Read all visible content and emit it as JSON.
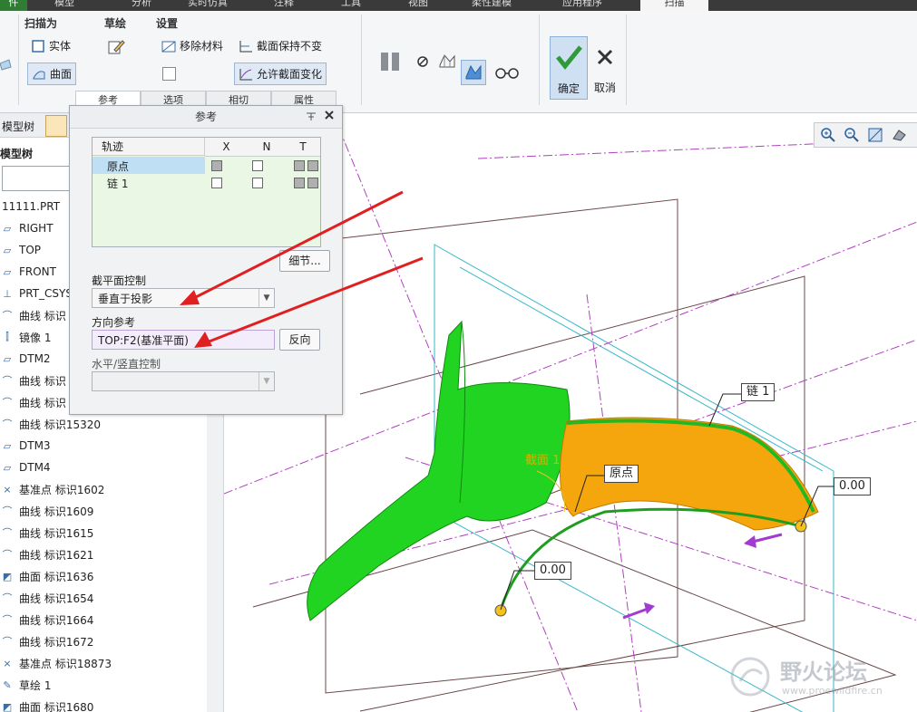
{
  "tabs": [
    {
      "label": "件"
    },
    {
      "label": "模型"
    },
    {
      "label": "分析"
    },
    {
      "label": "实时仿真"
    },
    {
      "label": "注释"
    },
    {
      "label": "工具"
    },
    {
      "label": "视图"
    },
    {
      "label": "柔性建模"
    },
    {
      "label": "应用程序"
    },
    {
      "label": "扫描"
    }
  ],
  "ribbon": {
    "sweep_as": {
      "title": "扫描为",
      "solid": "实体",
      "surface": "曲面"
    },
    "sketch": {
      "title": "草绘"
    },
    "settings": {
      "title": "设置",
      "remove_material": "移除材料",
      "keep_section": "截面保持不变",
      "allow_section_change": "允许截面变化"
    },
    "confirm": "确定",
    "cancel": "取消",
    "subtabs": [
      "参考",
      "选项",
      "相切",
      "属性"
    ]
  },
  "tree": {
    "tab_label": "模型树",
    "header": "模型树",
    "items": [
      {
        "label": "11111.PRT",
        "icon": "part-icon"
      },
      {
        "label": "RIGHT",
        "icon": "datum-plane-icon"
      },
      {
        "label": "TOP",
        "icon": "datum-plane-icon"
      },
      {
        "label": "FRONT",
        "icon": "datum-plane-icon"
      },
      {
        "label": "PRT_CSYS",
        "icon": "csys-icon"
      },
      {
        "label": "曲线 标识",
        "icon": "curve-icon"
      },
      {
        "label": "镜像 1",
        "icon": "mirror-icon"
      },
      {
        "label": "DTM2",
        "icon": "datum-plane-icon"
      },
      {
        "label": "曲线 标识",
        "icon": "curve-icon"
      },
      {
        "label": "曲线 标识",
        "icon": "curve-icon"
      },
      {
        "label": "曲线 标识15320",
        "icon": "curve-icon"
      },
      {
        "label": "DTM3",
        "icon": "datum-plane-icon"
      },
      {
        "label": "DTM4",
        "icon": "datum-plane-icon"
      },
      {
        "label": "基准点 标识1602",
        "icon": "datum-point-icon"
      },
      {
        "label": "曲线 标识1609",
        "icon": "curve-icon"
      },
      {
        "label": "曲线 标识1615",
        "icon": "curve-icon"
      },
      {
        "label": "曲线 标识1621",
        "icon": "curve-icon"
      },
      {
        "label": "曲面 标识1636",
        "icon": "surface-icon"
      },
      {
        "label": "曲线 标识1654",
        "icon": "curve-icon"
      },
      {
        "label": "曲线 标识1664",
        "icon": "curve-icon"
      },
      {
        "label": "曲线 标识1672",
        "icon": "curve-icon"
      },
      {
        "label": "基准点 标识18873",
        "icon": "datum-point-icon"
      },
      {
        "label": "草绘 1",
        "icon": "sketch-icon"
      },
      {
        "label": "曲面 标识1680",
        "icon": "surface-icon"
      }
    ]
  },
  "dialog": {
    "title": "参考",
    "table": {
      "headers": [
        "轨迹",
        "X",
        "N",
        "T"
      ],
      "rows": [
        {
          "name": "原点"
        },
        {
          "name": "链 1"
        }
      ]
    },
    "details_button": "细节...",
    "section_plane_label": "截平面控制",
    "section_plane_value": "垂直于投影",
    "direction_label": "方向参考",
    "direction_value": "TOP:F2(基准平面)",
    "flip_button": "反向",
    "hv_label": "水平/竖直控制",
    "hv_value": ""
  },
  "viewport": {
    "labels": {
      "chain": "链 1",
      "origin": "原点",
      "section": "截面 1",
      "dim_right": "0.00",
      "dim_left": "0.00"
    },
    "watermark_cn": "野火论坛",
    "watermark_url": "www.proewildfire.cn"
  },
  "colors": {
    "green_surface": "#1fd11f",
    "orange_surface": "#f5a30a",
    "annotation_arrow": "#e02020",
    "accent": "#2e7d32"
  }
}
